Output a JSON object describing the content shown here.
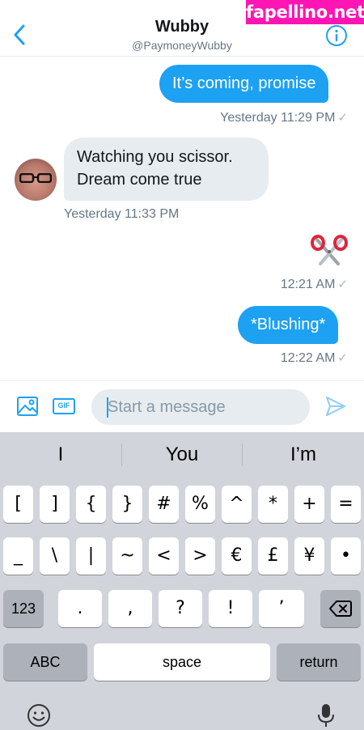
{
  "header": {
    "title": "Wubby",
    "handle": "@PaymoneyWubby",
    "back_icon": "chevron-left-icon",
    "info_icon": "info-icon",
    "accent": "#1da1f2"
  },
  "watermark": "fapellino.net",
  "messages": {
    "m1": {
      "text": "It’s coming, promise",
      "meta": "Yesterday 11:29 PM"
    },
    "m2": {
      "line1": "Watching you scissor.",
      "line2": "Dream come true",
      "meta": "Yesterday 11:33 PM"
    },
    "m3": {
      "emoji": "scissors",
      "meta": "12:21 AM"
    },
    "m4": {
      "text": "*Blushing*",
      "meta": "12:22 AM"
    }
  },
  "composer": {
    "placeholder": "Start a message",
    "image_icon": "image-icon",
    "gif_label": "GIF",
    "send_icon": "send-icon"
  },
  "keyboard": {
    "suggestions": [
      "I",
      "You",
      "I’m"
    ],
    "row1": [
      "[",
      "]",
      "{",
      "}",
      "#",
      "%",
      "^",
      "*",
      "+",
      "="
    ],
    "row2": [
      "_",
      "\\",
      "|",
      "~",
      "<",
      ">",
      "€",
      "£",
      "¥",
      "•"
    ],
    "row3": {
      "switch": "123",
      "keys": [
        ".",
        ",",
        "?",
        "!",
        "’"
      ],
      "delete_icon": "backspace-icon"
    },
    "row4": {
      "abc": "ABC",
      "space": "space",
      "return": "return"
    },
    "emoji_icon": "emoji-icon",
    "mic_icon": "microphone-icon"
  }
}
